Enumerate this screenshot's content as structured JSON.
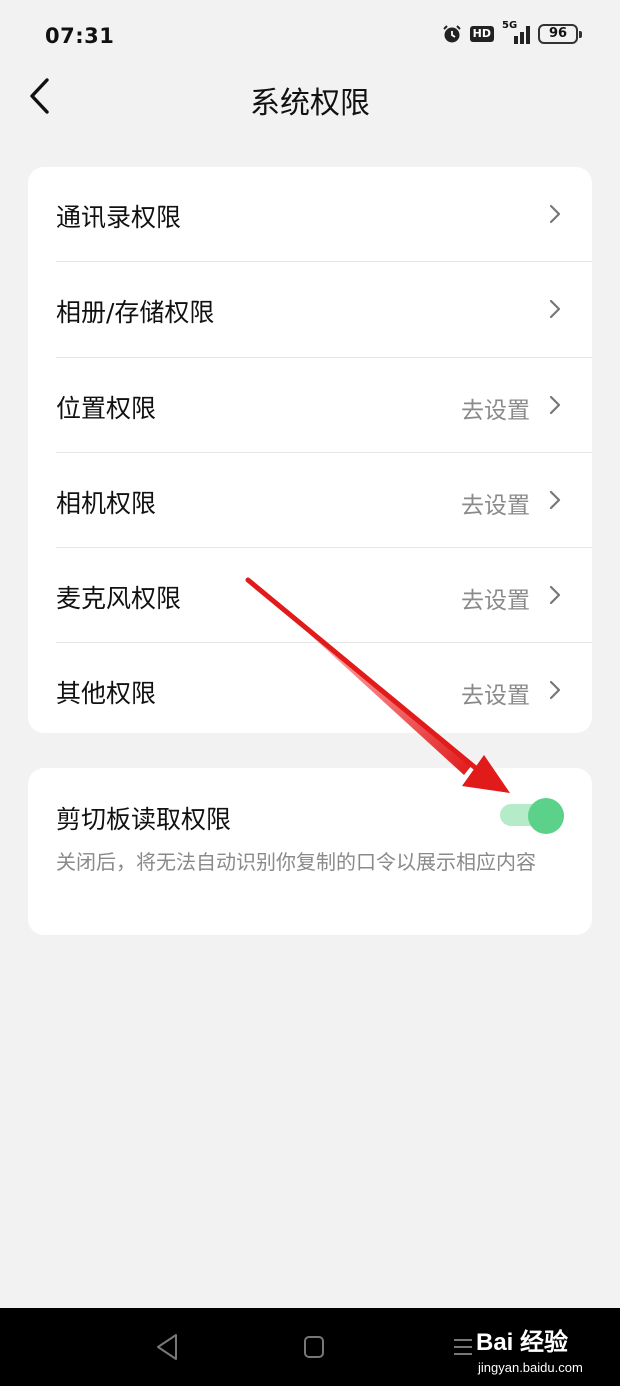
{
  "status_bar": {
    "time": "07:31",
    "hd_badge": "HD",
    "network": "5G",
    "battery": "96"
  },
  "header": {
    "title": "系统权限"
  },
  "permissions": {
    "items": [
      {
        "label": "通讯录权限",
        "action": ""
      },
      {
        "label": "相册/存储权限",
        "action": ""
      },
      {
        "label": "位置权限",
        "action": "去设置"
      },
      {
        "label": "相机权限",
        "action": "去设置"
      },
      {
        "label": "麦克风权限",
        "action": "去设置"
      },
      {
        "label": "其他权限",
        "action": "去设置"
      }
    ]
  },
  "clipboard": {
    "title": "剪切板读取权限",
    "description": "关闭后，将无法自动识别你复制的口令以展示相应内容",
    "enabled": true
  },
  "watermark": {
    "logo": "Bai 经验",
    "site": "jingyan.baidu.com"
  },
  "colors": {
    "background": "#f2f2f2",
    "toggle_on": "#5bd189",
    "toggle_track": "#b6ebc9",
    "annotation_arrow": "#e11a1a"
  }
}
